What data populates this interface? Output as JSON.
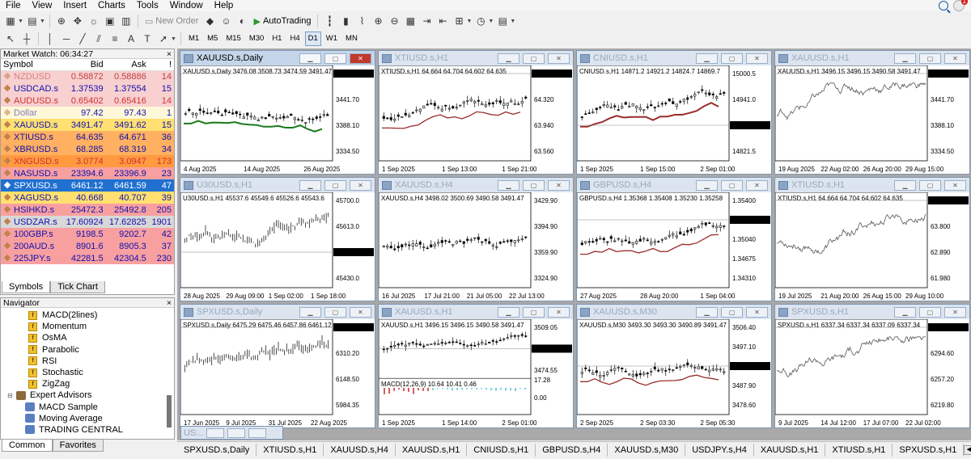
{
  "menu": [
    "File",
    "View",
    "Insert",
    "Charts",
    "Tools",
    "Window",
    "Help"
  ],
  "notification_count": "1",
  "toolbar": {
    "new_order": "New Order",
    "autotrading": "AutoTrading"
  },
  "timeframes": [
    "M1",
    "M5",
    "M15",
    "M30",
    "H1",
    "H4",
    "D1",
    "W1",
    "MN"
  ],
  "selected_timeframe": "D1",
  "market_watch": {
    "title": "Market Watch: 06:34:27",
    "headers": [
      "Symbol",
      "Bid",
      "Ask",
      "!"
    ],
    "rows": [
      {
        "symbol": "NZDUSD",
        "bid": "0.58872",
        "ask": "0.58886",
        "spread": "14",
        "bg": "#f8d0d0",
        "fg": "#c04040",
        "dim": true
      },
      {
        "symbol": "USDCAD.s",
        "bid": "1.37539",
        "ask": "1.37554",
        "spread": "15",
        "bg": "#f8d0d0",
        "fg": "#1010b0",
        "dim": false
      },
      {
        "symbol": "AUDUSD.s",
        "bid": "0.65402",
        "ask": "0.65416",
        "spread": "14",
        "bg": "#f8d0d0",
        "fg": "#d03030",
        "dim": false
      },
      {
        "symbol": "Dollar",
        "bid": "97.42",
        "ask": "97.43",
        "spread": "1",
        "bg": "#fff8d8",
        "fg": "#1010b0",
        "dim": true
      },
      {
        "symbol": "XAUUSD.s",
        "bid": "3491.47",
        "ask": "3491.62",
        "spread": "15",
        "bg": "#ffe070",
        "fg": "#1010b0",
        "dim": false
      },
      {
        "symbol": "XTIUSD.s",
        "bid": "64.635",
        "ask": "64.671",
        "spread": "36",
        "bg": "#ffb060",
        "fg": "#1010b0",
        "dim": false
      },
      {
        "symbol": "XBRUSD.s",
        "bid": "68.285",
        "ask": "68.319",
        "spread": "34",
        "bg": "#ffb060",
        "fg": "#1010b0",
        "dim": false
      },
      {
        "symbol": "XNGUSD.s",
        "bid": "3.0774",
        "ask": "3.0947",
        "spread": "173",
        "bg": "#ff9a40",
        "fg": "#d03030",
        "dim": false
      },
      {
        "symbol": "NASUSD.s",
        "bid": "23394.6",
        "ask": "23396.9",
        "spread": "23",
        "bg": "#f8a0a0",
        "fg": "#1010b0",
        "dim": false
      },
      {
        "symbol": "SPXUSD.s",
        "bid": "6461.12",
        "ask": "6461.59",
        "spread": "47",
        "bg": "#2070d0",
        "fg": "#ffffff",
        "dim": false
      },
      {
        "symbol": "XAGUSD.s",
        "bid": "40.668",
        "ask": "40.707",
        "spread": "39",
        "bg": "#ffe070",
        "fg": "#1010b0",
        "dim": false
      },
      {
        "symbol": "HSIHKD.s",
        "bid": "25472.3",
        "ask": "25492.8",
        "spread": "205",
        "bg": "#f8a0a0",
        "fg": "#1010b0",
        "dim": false
      },
      {
        "symbol": "USDZAR.s",
        "bid": "17.60924",
        "ask": "17.62825",
        "spread": "1901",
        "bg": "#d8d8d8",
        "fg": "#1010b0",
        "dim": false
      },
      {
        "symbol": "100GBP.s",
        "bid": "9198.5",
        "ask": "9202.7",
        "spread": "42",
        "bg": "#f8a0a0",
        "fg": "#1010b0",
        "dim": false
      },
      {
        "symbol": "200AUD.s",
        "bid": "8901.6",
        "ask": "8905.3",
        "spread": "37",
        "bg": "#f8a0a0",
        "fg": "#1010b0",
        "dim": false
      },
      {
        "symbol": "225JPY.s",
        "bid": "42281.5",
        "ask": "42304.5",
        "spread": "230",
        "bg": "#f8a0a0",
        "fg": "#1010b0",
        "dim": false
      }
    ],
    "tabs": [
      "Symbols",
      "Tick Chart"
    ]
  },
  "navigator": {
    "title": "Navigator",
    "items": [
      {
        "label": "MACD(2lines)",
        "kind": "ind"
      },
      {
        "label": "Momentum",
        "kind": "ind"
      },
      {
        "label": "OsMA",
        "kind": "ind"
      },
      {
        "label": "Parabolic",
        "kind": "ind"
      },
      {
        "label": "RSI",
        "kind": "ind"
      },
      {
        "label": "Stochastic",
        "kind": "ind"
      },
      {
        "label": "ZigZag",
        "kind": "ind"
      },
      {
        "label": "Expert Advisors",
        "kind": "folder"
      },
      {
        "label": "MACD Sample",
        "kind": "ea"
      },
      {
        "label": "Moving Average",
        "kind": "ea"
      },
      {
        "label": "TRADING CENTRAL",
        "kind": "ea"
      }
    ],
    "tabs": [
      "Common",
      "Favorites"
    ]
  },
  "charts": [
    {
      "title": "XAUUSD.s,Daily",
      "info": "XAUUSD.s,Daily  3476.08 3508.73 3474.59 3491.47",
      "prices": [
        "3491.47",
        "3441.70",
        "3388.10",
        "3334.50"
      ],
      "dates": [
        "4 Aug 2025",
        "14 Aug 2025",
        "26 Aug 2025"
      ],
      "last": "3491.47",
      "kind": "candle"
    },
    {
      "title": "XTIUSD.s,H1",
      "info": "XTIUSD.s,H1  64.664 64.704 64.602 64.635",
      "prices": [
        "64.635",
        "64.320",
        "63.940",
        "63.560"
      ],
      "dates": [
        "1 Sep 2025",
        "1 Sep 13:00",
        "1 Sep 21:00"
      ],
      "last": "64.635",
      "kind": "candle"
    },
    {
      "title": "CNIUSD.s,H1",
      "info": "CNIUSD.s,H1  14871.2 14921.2 14824.7 14869.7",
      "prices": [
        "15000.5",
        "14941.0",
        "14869.7",
        "14821.5"
      ],
      "dates": [
        "1 Sep 2025",
        "1 Sep 15:00",
        "2 Sep 01:00"
      ],
      "last": "14869.7",
      "kind": "candle"
    },
    {
      "title": "XAUUSD.s,H1",
      "info": "XAUUSD.s,H1  3496.15 3496.15 3490.58 3491.47",
      "prices": [
        "3491.47",
        "3441.70",
        "3388.10",
        "3334.50"
      ],
      "dates": [
        "19 Aug 2025",
        "22 Aug 02:00",
        "26 Aug 20:00",
        "29 Aug 15:00"
      ],
      "last": "3491.47",
      "kind": "line"
    },
    {
      "title": "U30USD.s,H1",
      "info": "U30USD.s,H1  45537.6 45549.6 45526.6 45543.6",
      "prices": [
        "45700.0",
        "45613.0",
        "45543.6",
        "45430.0"
      ],
      "dates": [
        "28 Aug 2025",
        "29 Aug 09:00",
        "1 Sep 02:00",
        "1 Sep 18:00"
      ],
      "last": "45543.6",
      "kind": "bar"
    },
    {
      "title": "XAUUSD.s,H4",
      "info": "XAUUSD.s,H4  3498.02 3500.69 3490.58 3491.47",
      "prices": [
        "3429.90",
        "3394.90",
        "3359.90",
        "3324.90"
      ],
      "dates": [
        "16 Jul 2025",
        "17 Jul 21:00",
        "21 Jul 05:00",
        "22 Jul 13:00"
      ],
      "last": "",
      "kind": "candle"
    },
    {
      "title": "GBPUSD.s,H4",
      "info": "GBPUSD.s,H4  1.35368 1.35408 1.35230 1.35258",
      "prices": [
        "1.35400",
        "1.35258",
        "1.35040",
        "1.34675",
        "1.34310"
      ],
      "dates": [
        "27 Aug 2025",
        "28 Aug 20:00",
        "1 Sep 04:00"
      ],
      "last": "1.35258",
      "kind": "candle"
    },
    {
      "title": "XTIUSD.s,H1",
      "info": "XTIUSD.s,H1  64.664 64.704 64.602 64.635",
      "prices": [
        "64.635",
        "63.800",
        "62.890",
        "61.980"
      ],
      "dates": [
        "19 Jul 2025",
        "21 Aug 20:00",
        "26 Aug 15:00",
        "29 Aug 10:00"
      ],
      "last": "64.635",
      "kind": "line"
    },
    {
      "title": "SPXUSD.s,Daily",
      "info": "SPXUSD.s,Daily  6475.29 6475.46 6457.86 6461.12",
      "prices": [
        "6461.12",
        "6310.20",
        "6148.50",
        "5984.35"
      ],
      "dates": [
        "17 Jun 2025",
        "9 Jul 2025",
        "31 Jul 2025",
        "22 Aug 2025"
      ],
      "last": "6461.12",
      "kind": "bar"
    },
    {
      "title": "XAUUSD.s,H1",
      "info": "XAUUSD.s,H1  3496.15 3496.15 3490.58 3491.47",
      "prices": [
        "3509.05",
        "3491.47",
        "3474.55"
      ],
      "macd_prices": [
        "17.28",
        "0.00"
      ],
      "macd_label": "MACD(12,26,9)  10.64 10.41 0.46",
      "dates": [
        "1 Sep 2025",
        "1 Sep 14:00",
        "2 Sep 01:00"
      ],
      "last": "3491.47",
      "kind": "macd"
    },
    {
      "title": "XAUUSD.s,M30",
      "info": "XAUUSD.s,M30  3493.30 3493.30 3490.89 3491.47",
      "prices": [
        "3506.40",
        "3497.10",
        "3491.47",
        "3487.90",
        "3478.60"
      ],
      "dates": [
        "2 Sep 2025",
        "2 Sep 03:30",
        "2 Sep 05:30"
      ],
      "last": "3491.47",
      "kind": "candle"
    },
    {
      "title": "SPXUSD.s,H1",
      "info": "SPXUSD.s,H1  6337.34 6337.34 6337.09 6337.34",
      "prices": [
        "6337.34",
        "6294.60",
        "6257.20",
        "6219.80"
      ],
      "dates": [
        "9 Jul 2025",
        "14 Jul 12:00",
        "17 Jul 07:00",
        "22 Jul 02:00"
      ],
      "last": "6337.34",
      "kind": "line"
    }
  ],
  "minimized_window": "US...",
  "sheet_tabs": [
    "SPXUSD.s,Daily",
    "XTIUSD.s,H1",
    "XAUUSD.s,H4",
    "XAUUSD.s,H1",
    "CNIUSD.s,H1",
    "GBPUSD.s,H4",
    "XAUUSD.s,M30",
    "USDJPY.s,H4",
    "XAUUSD.s,H1",
    "XTIUSD.s,H1",
    "SPXUSD.s,H1"
  ]
}
